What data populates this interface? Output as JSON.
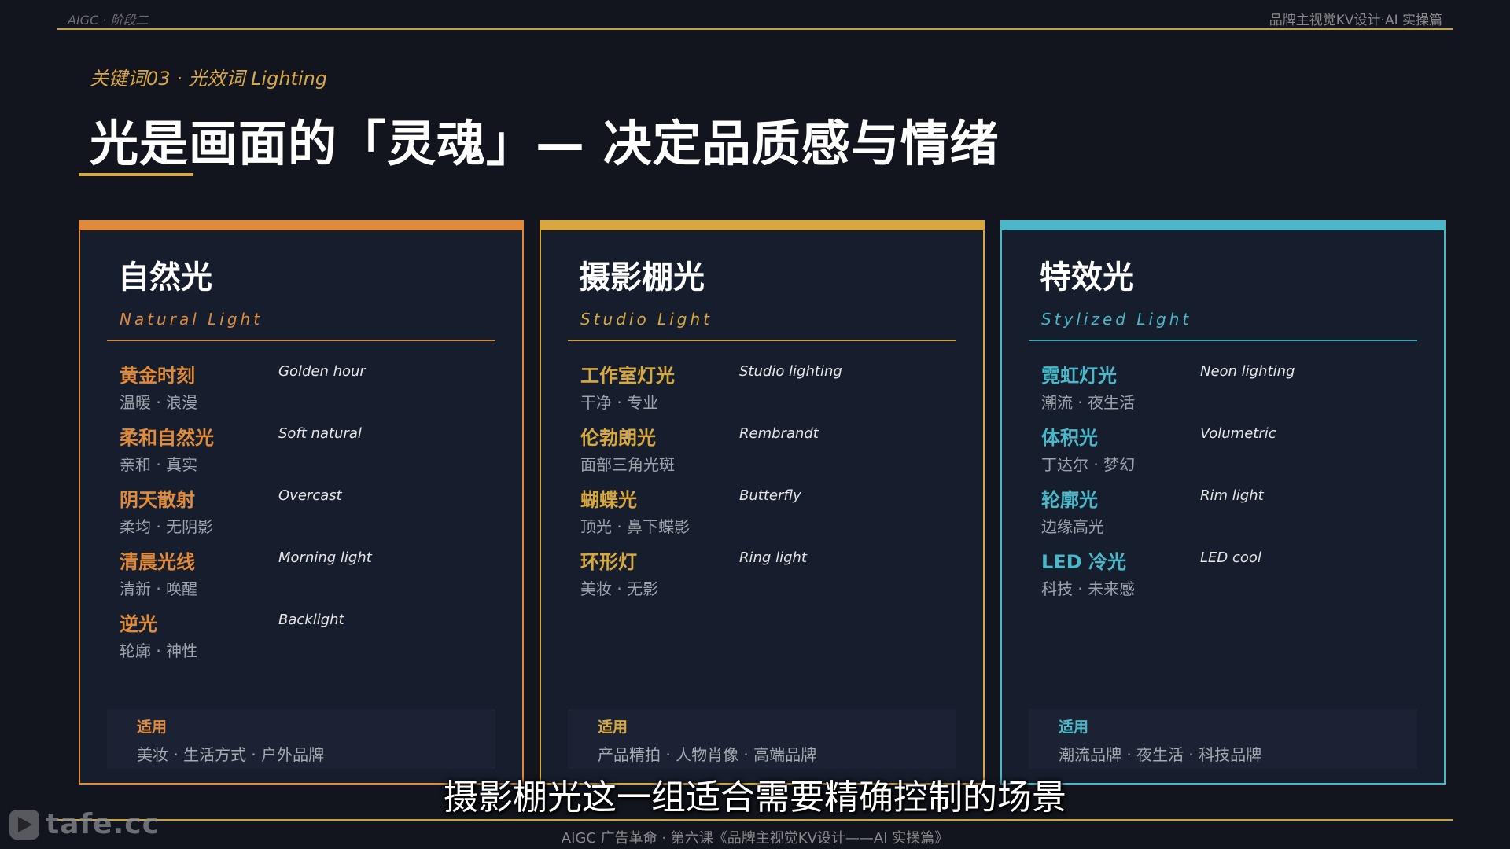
{
  "header": {
    "left": "AIGC · 阶段二",
    "right": "品牌主视觉KV设计·AI 实操篇"
  },
  "kicker": "关键词03 · 光效词 Lighting",
  "title": "光是画面的「灵魂」— 决定品质感与情绪",
  "colors": {
    "gold": "#d7a94a",
    "natural": "#e08a3c",
    "studio": "#d7a83f",
    "stylized": "#4ab8c8"
  },
  "cards": [
    {
      "title": "自然光",
      "subtitle": "Natural Light",
      "items": [
        {
          "name": "黄金时刻",
          "desc": "温暖 · 浪漫",
          "en": "Golden hour"
        },
        {
          "name": "柔和自然光",
          "desc": "亲和 · 真实",
          "en": "Soft natural"
        },
        {
          "name": "阴天散射",
          "desc": "柔均 · 无阴影",
          "en": "Overcast"
        },
        {
          "name": "清晨光线",
          "desc": "清新 · 唤醒",
          "en": "Morning light"
        },
        {
          "name": "逆光",
          "desc": "轮廓 · 神性",
          "en": "Backlight"
        }
      ],
      "usage_label": "适用",
      "usage_value": "美妆 · 生活方式 · 户外品牌"
    },
    {
      "title": "摄影棚光",
      "subtitle": "Studio Light",
      "items": [
        {
          "name": "工作室灯光",
          "desc": "干净 · 专业",
          "en": "Studio lighting"
        },
        {
          "name": "伦勃朗光",
          "desc": "面部三角光斑",
          "en": "Rembrandt"
        },
        {
          "name": "蝴蝶光",
          "desc": "顶光 · 鼻下蝶影",
          "en": "Butterfly"
        },
        {
          "name": "环形灯",
          "desc": "美妆 · 无影",
          "en": "Ring light"
        }
      ],
      "usage_label": "适用",
      "usage_value": "产品精拍 · 人物肖像 · 高端品牌"
    },
    {
      "title": "特效光",
      "subtitle": "Stylized Light",
      "items": [
        {
          "name": "霓虹灯光",
          "desc": "潮流 · 夜生活",
          "en": "Neon lighting"
        },
        {
          "name": "体积光",
          "desc": "丁达尔 · 梦幻",
          "en": "Volumetric"
        },
        {
          "name": "轮廓光",
          "desc": "边缘高光",
          "en": "Rim light"
        },
        {
          "name": "LED 冷光",
          "desc": "科技 · 未来感",
          "en": "LED cool"
        }
      ],
      "usage_label": "适用",
      "usage_value": "潮流品牌 · 夜生活 · 科技品牌"
    }
  ],
  "subtitle_caption": "摄影棚光这一组适合需要精确控制的场景",
  "footer": "AIGC 广告革命 · 第六课《品牌主视觉KV设计——AI 实操篇》",
  "watermark": "tafe.cc"
}
